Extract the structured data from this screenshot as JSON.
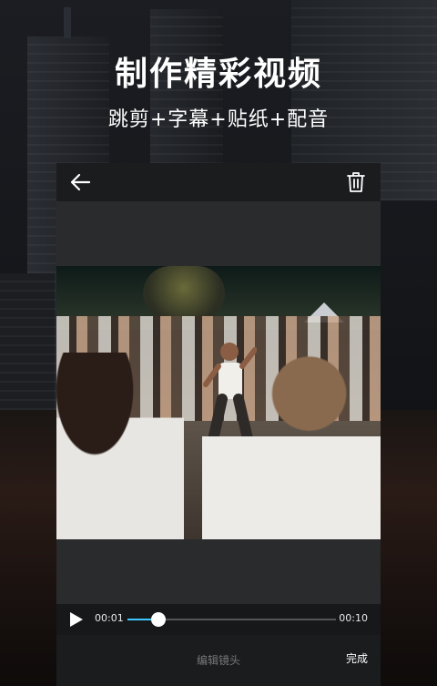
{
  "promo": {
    "headline": "制作精彩视频",
    "subline": "跳剪+字幕+贴纸+配音"
  },
  "editor": {
    "icons": {
      "back": "arrow-left-icon",
      "delete": "trash-icon",
      "play": "play-icon"
    },
    "player": {
      "current_time": "00:01",
      "end_time": "00:10",
      "progress": 0.15,
      "accent_color": "#3cc8ff"
    },
    "bottom": {
      "edit_label": "编辑镜头",
      "done_label": "完成"
    }
  }
}
